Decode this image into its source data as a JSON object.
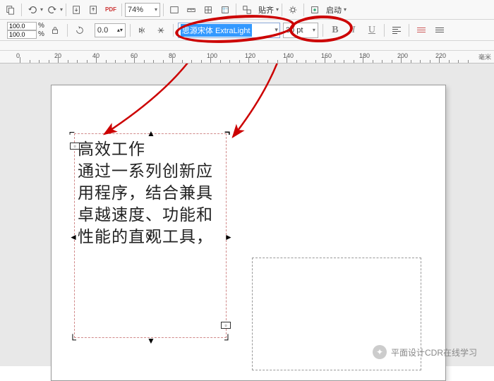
{
  "toolbar1": {
    "zoom": "74%",
    "paste_label": "贴齐",
    "launch_label": "启动"
  },
  "toolbar2": {
    "nudge_x": "100.0",
    "nudge_y": "100.0",
    "nudge_unit": "%",
    "angle": "0.0",
    "font_name": "思源宋体 ExtraLight",
    "font_size": "30 pt",
    "bold": "B",
    "italic": "I",
    "underline": "U"
  },
  "ruler": {
    "marks": [
      "0",
      "20",
      "40",
      "60",
      "80",
      "100",
      "120",
      "140",
      "160",
      "180",
      "200",
      "220"
    ],
    "unit_label": "毫米"
  },
  "text_frame_1": {
    "content": "高效工作\n通过一系列创新应用程序，结合兼具\n卓越速度、功能和性能的直观工具，"
  },
  "watermark": {
    "label": "平面设计CDR在线学习"
  },
  "icons": {
    "copy": "copy-icon",
    "undo": "undo-icon",
    "redo": "redo-icon",
    "import": "import-icon",
    "export": "export-icon",
    "pdf": "PDF",
    "fullscreen": "fullscreen-icon",
    "grid": "grid-icon",
    "guides": "guides-icon",
    "snap": "snap-icon",
    "options": "options-icon",
    "rotation": "rotation-icon",
    "mirror_h": "mirror-horizontal-icon",
    "mirror_v": "mirror-vertical-icon",
    "bullets": "bullets-icon",
    "numbering": "numbering-icon"
  }
}
